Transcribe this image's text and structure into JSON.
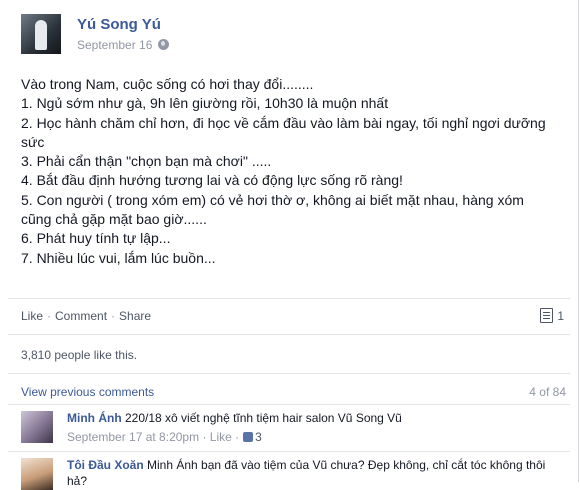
{
  "post": {
    "author": "Yú Song Yú",
    "date": "September 16",
    "privacy_icon": "globe-icon",
    "lines": [
      "Vào trong Nam, cuộc sống có hơi thay đổi........",
      "1. Ngủ sớm như gà, 9h lên giường rồi, 10h30 là muộn nhất",
      "2. Học hành chăm chỉ hơn, đi học về cắm đầu vào làm bài ngay, tối nghỉ ngơi dưỡng",
      "sức",
      "3. Phải cẩn thận \"chọn bạn mà chơi\" .....",
      "4. Bắt đầu định hướng tương lai và có động lực sống rõ ràng!",
      "5. Con người ( trong xóm em) có vẻ hơi thờ ơ, không ai biết mặt nhau, hàng xóm",
      "cũng chả gặp mặt bao giờ......",
      "6. Phát huy tính tự lập...",
      "7. Nhiều lúc vui, lắm lúc buồn..."
    ]
  },
  "actions": {
    "like": "Like",
    "comment": "Comment",
    "share": "Share",
    "share_count": "1",
    "likes_text": "3,810 people like this."
  },
  "comments_section": {
    "view_previous": "View previous comments",
    "counter": "4 of 84"
  },
  "comments": [
    {
      "name": "Minh Ánh",
      "text": "220/18 xô viết nghệ tĩnh tiệm hair salon Vũ Song Vũ",
      "time": "September 17 at 8:20pm",
      "like_label": "Like",
      "like_count": "3"
    },
    {
      "name": "Tôi Đầu Xoăn",
      "text": "Minh Ánh bạn đã vào tiệm của Vũ chưa? Đẹp không, chỉ cắt tóc không thôi hả?"
    }
  ],
  "colors": {
    "link": "#3b5998",
    "muted": "#9197a3",
    "text": "#141823"
  }
}
